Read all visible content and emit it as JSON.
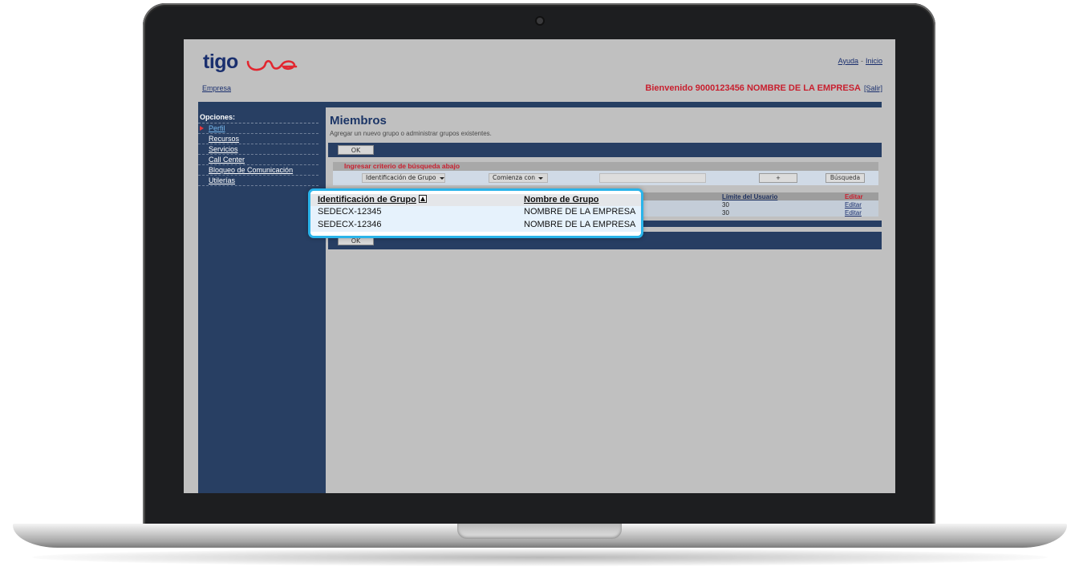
{
  "brand": {
    "logo_text": "tigo",
    "logo_mark": "une"
  },
  "header": {
    "help_label": "Ayuda",
    "separator": "-",
    "home_label": "Inicio",
    "company_link": "Empresa",
    "welcome_text": "Bienvenido 9000123456  NOMBRE DE LA EMPRESA",
    "logout_label": "[Salir]"
  },
  "sidebar": {
    "heading": "Opciones:",
    "items": [
      {
        "label": "Perfil",
        "active": true
      },
      {
        "label": "Recursos"
      },
      {
        "label": "Servicios"
      },
      {
        "label": "Call Center"
      },
      {
        "label": "Bloqueo de Comunicación"
      },
      {
        "label": "Utilerías"
      }
    ]
  },
  "main": {
    "title": "Miembros",
    "subtitle": "Agregar un nuevo grupo o administrar grupos existentes.",
    "ok_label": "OK",
    "search": {
      "heading": "Ingresar criterio de búsqueda abajo",
      "field_select": "Identificación de Grupo",
      "mode_select": "Comienza con",
      "query_value": "",
      "plus_label": "+",
      "search_label": "Búsqueda"
    },
    "table": {
      "headers": {
        "group_id": "Identificación de Grupo",
        "group_name": "Nombre de Grupo",
        "user_limit": "Límite del Usuario",
        "edit": "Editar"
      },
      "rows": [
        {
          "group_id": "SEDECX-12345",
          "group_name": "NOMBRE DE LA EMPRESA",
          "user_limit": "30",
          "edit": "Editar"
        },
        {
          "group_id": "SEDECX-12346",
          "group_name": "NOMBRE DE LA EMPRESA",
          "user_limit": "30",
          "edit": "Editar"
        }
      ]
    }
  },
  "colors": {
    "navy": "#273e63",
    "accent_red": "#c8202f",
    "callout_border": "#2ab4ea",
    "screen_bg": "#c0c0c0"
  },
  "icons": [
    "camera-icon",
    "sort-ascending-icon",
    "dropdown-caret-icon",
    "active-arrow-icon"
  ]
}
